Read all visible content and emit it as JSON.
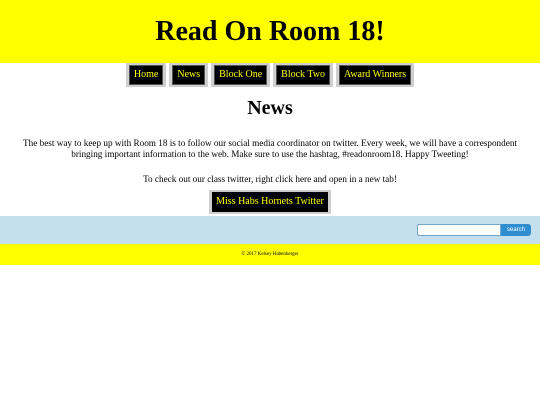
{
  "header": {
    "title": "Read On Room 18!"
  },
  "nav": {
    "items": [
      {
        "label": "Home"
      },
      {
        "label": "News"
      },
      {
        "label": "Block One"
      },
      {
        "label": "Block Two"
      },
      {
        "label": "Award Winners"
      }
    ]
  },
  "main": {
    "heading": "News",
    "paragraph": "The best way to keep up with Room 18 is to follow our social media coordinator on twitter. Every week, we will have a correspondent bringing important information to the web. Make sure to use the hashtag, #readonroom18. Happy Tweeting!",
    "cta_text": "To check out our class twitter, right click here and open in a new tab!",
    "twitter_label": "Miss Habs Hornets Twitter"
  },
  "search": {
    "value": "",
    "placeholder": "",
    "button_label": "search"
  },
  "footer": {
    "text": "© 2017 Kelsey Habenberger"
  },
  "colors": {
    "banner": "#ffff00",
    "nav_bg": "#000000",
    "nav_text": "#ffff00",
    "search_bar": "#c4dfee",
    "search_button": "#2f8ed0"
  }
}
